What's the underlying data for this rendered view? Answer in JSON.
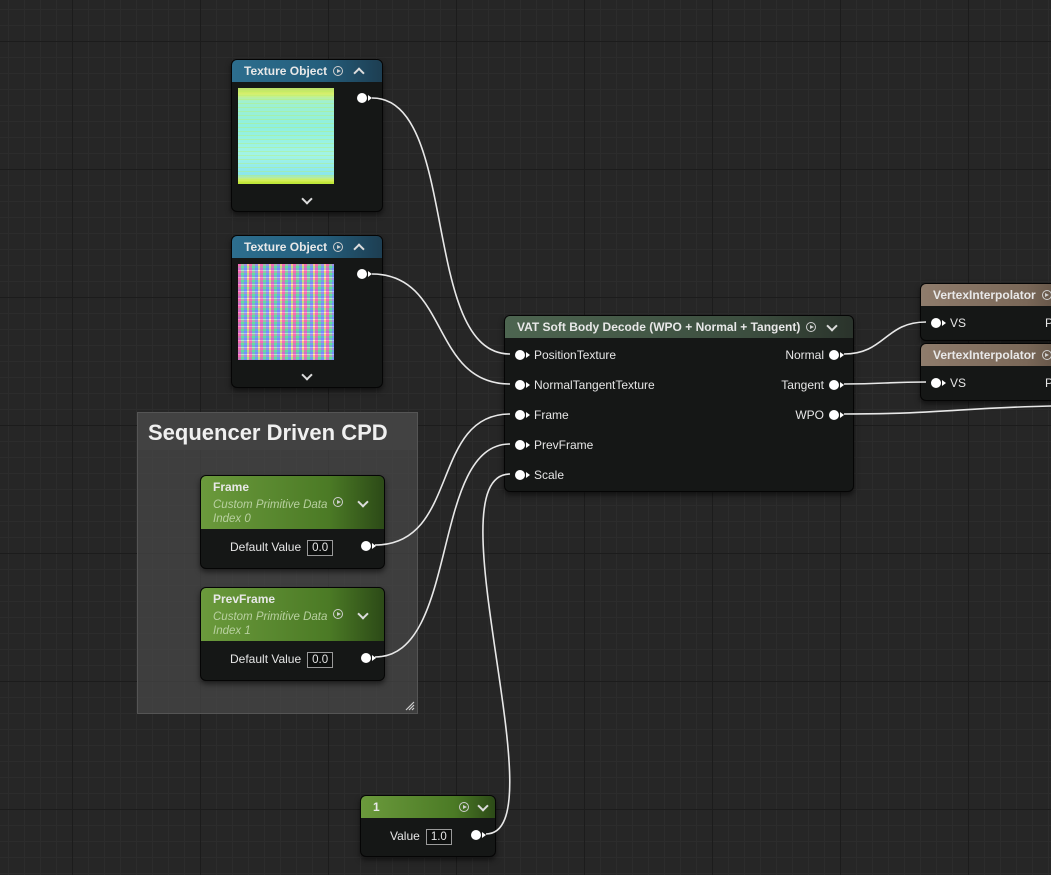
{
  "texture_object_1": {
    "title": "Texture Object"
  },
  "texture_object_2": {
    "title": "Texture Object"
  },
  "comment_box": {
    "title": "Sequencer Driven CPD"
  },
  "frame_node": {
    "title": "Frame",
    "subtitle": "Custom Primitive Data",
    "index_label": "Index 0",
    "default_label": "Default Value",
    "default_value": "0.0"
  },
  "prevframe_node": {
    "title": "PrevFrame",
    "subtitle": "Custom Primitive Data",
    "index_label": "Index 1",
    "default_label": "Default Value",
    "default_value": "0.0"
  },
  "vat_node": {
    "title": "VAT Soft Body Decode (WPO + Normal + Tangent)",
    "inputs": [
      "PositionTexture",
      "NormalTangentTexture",
      "Frame",
      "PrevFrame",
      "Scale"
    ],
    "outputs": [
      "Normal",
      "Tangent",
      "WPO"
    ]
  },
  "vertex_interpolator_1": {
    "title": "VertexInterpolator",
    "input": "VS",
    "output_partial": "P"
  },
  "vertex_interpolator_2": {
    "title": "VertexInterpolator",
    "input": "VS",
    "output_partial": "P"
  },
  "constant_node": {
    "title": "1",
    "value_label": "Value",
    "value": "1.0"
  },
  "colors": {
    "background": "#262626",
    "texture_header": "#2d6e8e",
    "param_header": "#5a8a30",
    "function_header": "#4d6550",
    "interpolator_header": "#8f7c6c",
    "wire": "#e8e8e8"
  }
}
